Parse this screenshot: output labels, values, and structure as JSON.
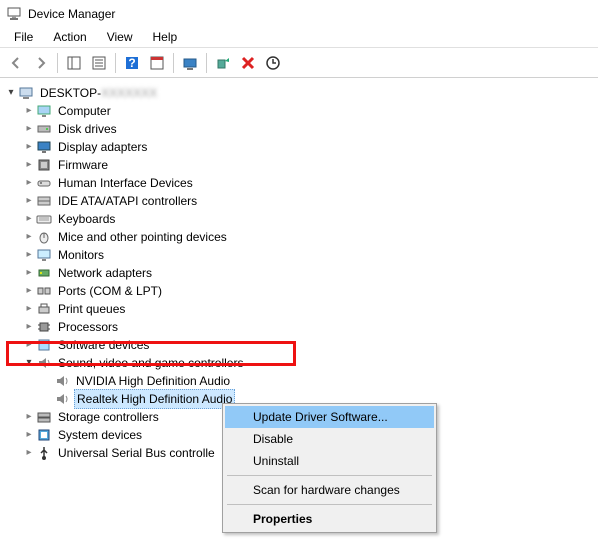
{
  "window": {
    "title": "Device Manager"
  },
  "menu": {
    "file": "File",
    "action": "Action",
    "view": "View",
    "help": "Help"
  },
  "tree": {
    "root": "DESKTOP-",
    "root_suffix": "XXXXXXX",
    "items": [
      "Computer",
      "Disk drives",
      "Display adapters",
      "Firmware",
      "Human Interface Devices",
      "IDE ATA/ATAPI controllers",
      "Keyboards",
      "Mice and other pointing devices",
      "Monitors",
      "Network adapters",
      "Ports (COM & LPT)",
      "Print queues",
      "Processors",
      "Software devices",
      "Sound, video and game controllers",
      "Storage controllers",
      "System devices",
      "Universal Serial Bus controlle"
    ],
    "audio_children": [
      "NVIDIA High Definition Audio",
      "Realtek High Definition Audio"
    ]
  },
  "context_menu": {
    "items": [
      "Update Driver Software...",
      "Disable",
      "Uninstall",
      "Scan for hardware changes",
      "Properties"
    ]
  }
}
